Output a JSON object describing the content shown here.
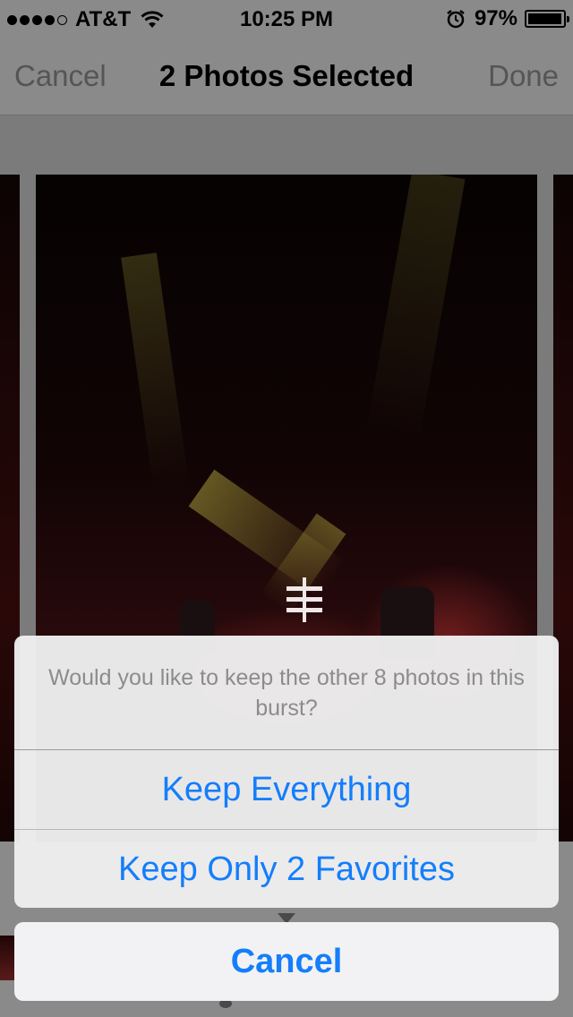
{
  "status_bar": {
    "carrier": "AT&T",
    "time": "10:25 PM",
    "battery_percent": "97%",
    "battery_level": 0.97,
    "signal_bars_filled": 4,
    "signal_bars_total": 5
  },
  "nav": {
    "cancel_label": "Cancel",
    "title": "2 Photos Selected",
    "done_label": "Done"
  },
  "action_sheet": {
    "message": "Would you like to keep the other 8 photos in this burst?",
    "keep_everything_label": "Keep Everything",
    "keep_favorites_label": "Keep Only 2 Favorites",
    "cancel_label": "Cancel"
  },
  "colors": {
    "accent": "#147efb",
    "dimmed_text": "#555555",
    "message_text": "#8c8c8c"
  }
}
